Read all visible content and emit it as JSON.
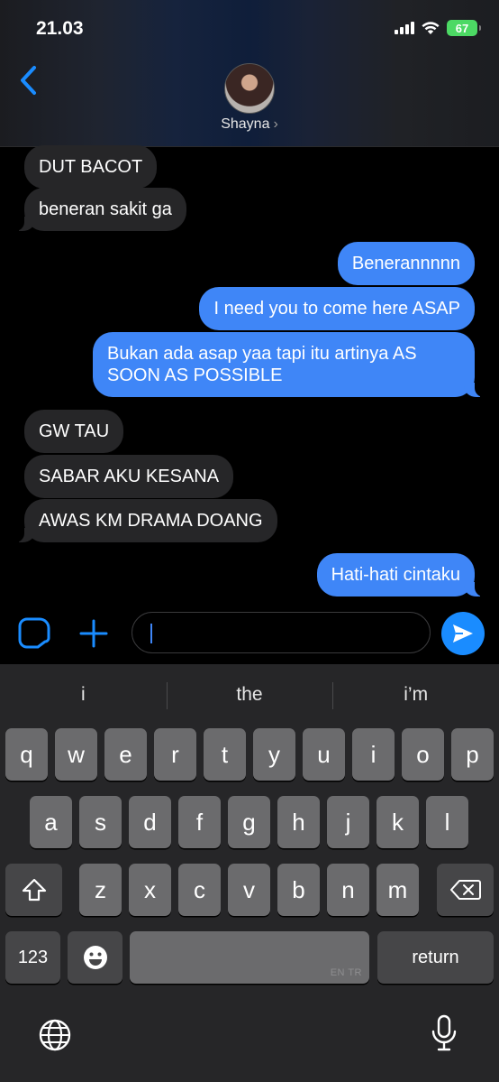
{
  "status_bar": {
    "time": "21.03",
    "battery": "67"
  },
  "header": {
    "contact_name": "Shayna",
    "chevron": "›"
  },
  "messages": [
    {
      "side": "in",
      "text": "DUT BACOT"
    },
    {
      "side": "in",
      "text": "beneran sakit ga"
    },
    {
      "side": "out",
      "text": "Benerannnnn"
    },
    {
      "side": "out",
      "text": "I need you to come here ASAP"
    },
    {
      "side": "out",
      "text": "Bukan ada asap yaa tapi itu artinya AS SOON AS POSSIBLE"
    },
    {
      "side": "in",
      "text": "GW TAU"
    },
    {
      "side": "in",
      "text": "SABAR AKU KESANA"
    },
    {
      "side": "in",
      "text": "AWAS KM DRAMA DOANG"
    },
    {
      "side": "out",
      "text": "Hati-hati cintaku"
    }
  ],
  "composer": {
    "value": ""
  },
  "keyboard": {
    "suggestions": [
      "i",
      "the",
      "i’m"
    ],
    "row1": [
      "q",
      "w",
      "e",
      "r",
      "t",
      "y",
      "u",
      "i",
      "o",
      "p"
    ],
    "row2": [
      "a",
      "s",
      "d",
      "f",
      "g",
      "h",
      "j",
      "k",
      "l"
    ],
    "row3": [
      "z",
      "x",
      "c",
      "v",
      "b",
      "n",
      "m"
    ],
    "numbers_label": "123",
    "return_label": "return",
    "space_hint": "EN TR"
  },
  "colors": {
    "outgoing_bubble": "#3f86f7",
    "incoming_bubble": "#262628",
    "accent": "#1a8cff"
  }
}
